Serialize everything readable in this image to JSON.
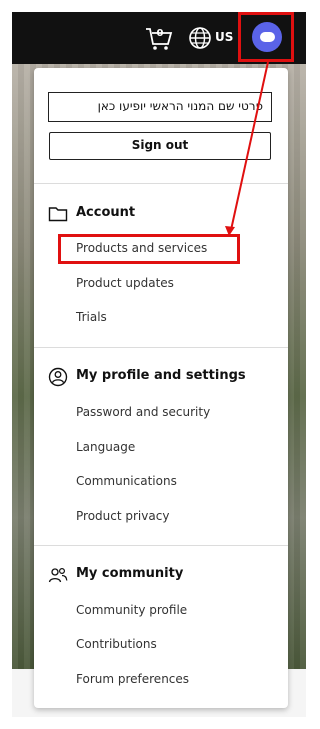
{
  "header": {
    "cart_count": "0",
    "region": "US",
    "icons": [
      "cart-icon",
      "globe-icon",
      "avatar-icon"
    ]
  },
  "account_menu": {
    "name_placeholder": "פרטי שם המנוי הראשי יופיעו כאן",
    "sign_out": "Sign out",
    "sections": [
      {
        "title": "Account",
        "icon": "folder-icon",
        "items": [
          "Products and services",
          "Product updates",
          "Trials"
        ]
      },
      {
        "title": "My profile and settings",
        "icon": "user-circle-icon",
        "items": [
          "Password and security",
          "Language",
          "Communications",
          "Product privacy"
        ]
      },
      {
        "title": "My community",
        "icon": "people-icon",
        "items": [
          "Community profile",
          "Contributions",
          "Forum preferences"
        ]
      }
    ]
  },
  "annotation": {
    "highlight_color": "#e01010",
    "highlighted_item": "Products and services"
  },
  "colors": {
    "header_bg": "#111111",
    "avatar": "#5a63e8"
  }
}
